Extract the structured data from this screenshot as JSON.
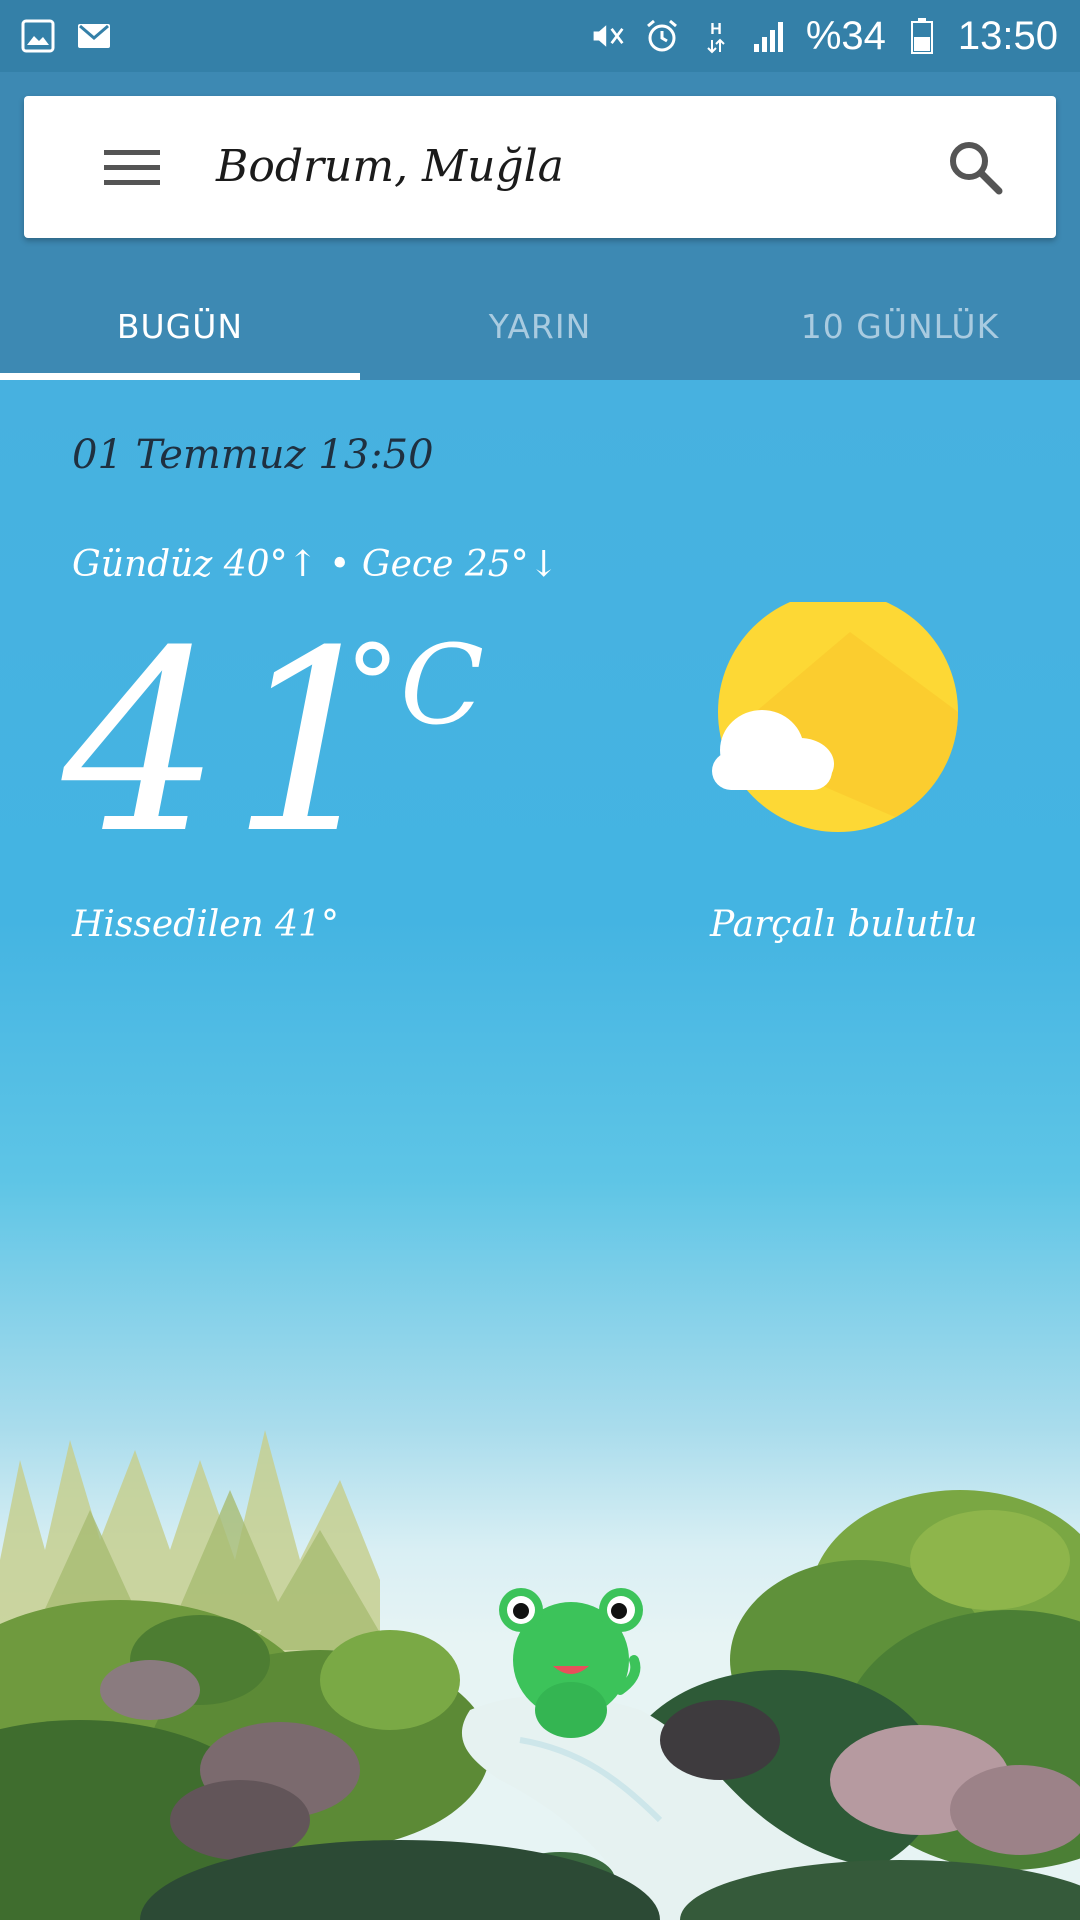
{
  "status_bar": {
    "battery_percent": "%34",
    "time": "13:50",
    "icons": [
      "gallery-icon",
      "email-icon",
      "mute-icon",
      "alarm-icon",
      "hspa-icon",
      "signal-icon",
      "battery-icon"
    ]
  },
  "search": {
    "location": "Bodrum, Muğla"
  },
  "tabs": [
    {
      "label": "BUGÜN",
      "active": true
    },
    {
      "label": "YARIN",
      "active": false
    },
    {
      "label": "10 GÜNLÜK",
      "active": false
    }
  ],
  "weather": {
    "date_time": "01 Temmuz 13:50",
    "high_low": "Gündüz 40°↑ • Gece 25°↓",
    "temperature": "41",
    "unit": "°C",
    "feels_like": "Hissedilen 41°",
    "condition": "Parçalı bulutlu",
    "condition_icon": "partly-cloudy-icon"
  },
  "colors": {
    "status_bar": "#3480a8",
    "header": "#3d89b3",
    "sky_top": "#47b1e0",
    "sun": "#fdd835",
    "frog": "#3cc35a"
  }
}
